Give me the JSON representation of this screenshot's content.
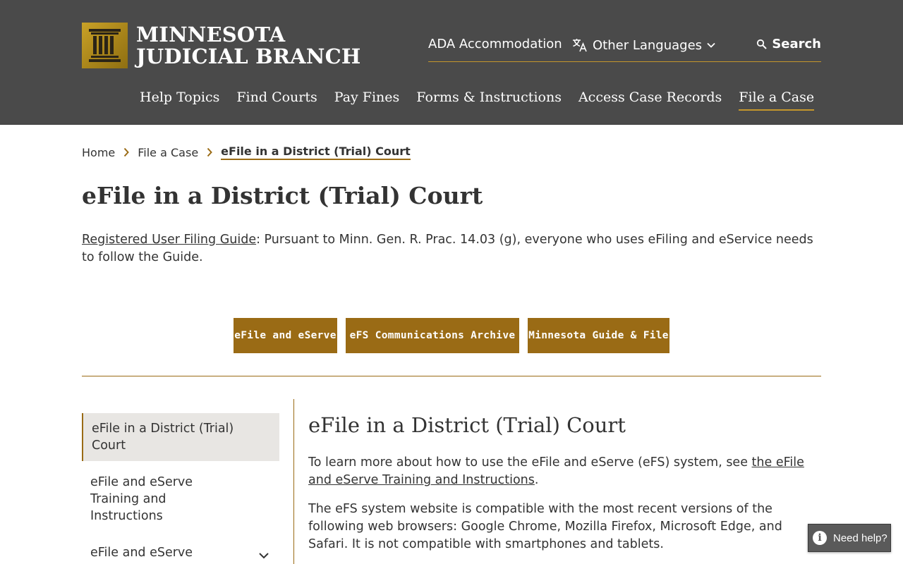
{
  "header": {
    "logo_line1": "MINNESOTA",
    "logo_line2": "JUDICIAL BRANCH",
    "utility": {
      "ada": "ADA Accommodation",
      "languages": "Other Languages",
      "search": "Search"
    },
    "nav": [
      {
        "label": "Help Topics"
      },
      {
        "label": "Find Courts"
      },
      {
        "label": "Pay Fines"
      },
      {
        "label": "Forms & Instructions"
      },
      {
        "label": "Access Case Records"
      },
      {
        "label": "File a Case",
        "active": true
      }
    ]
  },
  "breadcrumb": {
    "items": [
      "Home",
      "File a Case"
    ],
    "current": "eFile in a District (Trial) Court"
  },
  "page": {
    "title": "eFile in a District (Trial) Court",
    "intro_link": "Registered User Filing Guide",
    "intro_text": ": Pursuant to Minn. Gen. R. Prac. 14.03 (g), everyone who uses eFiling and eService needs to follow the Guide."
  },
  "buttons": [
    {
      "label": "eFile and eServe"
    },
    {
      "label": "eFS Communications Archive"
    },
    {
      "label": "Minnesota Guide & File"
    }
  ],
  "sidenav": {
    "items": [
      {
        "label": "eFile in a District (Trial) Court",
        "active": true
      },
      {
        "label": "eFile and eServe Training and Instructions"
      },
      {
        "label": "eFile and eServe Resources",
        "expandable": true
      }
    ]
  },
  "content": {
    "heading": "eFile in a District (Trial) Court",
    "p1_before": "To learn more about how to use the eFile and eServe (eFS) system, see ",
    "p1_link": "the eFile and eServe Training and Instructions",
    "p1_after": ".",
    "p2": "The eFS system website is compatible with the most recent versions of the following web browsers: Google Chrome, Mozilla Firefox, Microsoft Edge, and Safari. It is not compatible with smartphones and tablets."
  },
  "help_widget": {
    "label": "Need help?"
  },
  "colors": {
    "header_bg": "#4a4a4a",
    "accent_gold": "#9a6b15",
    "underline_gold": "#c5972c",
    "sidenav_active_bg": "#e8e6e3"
  }
}
